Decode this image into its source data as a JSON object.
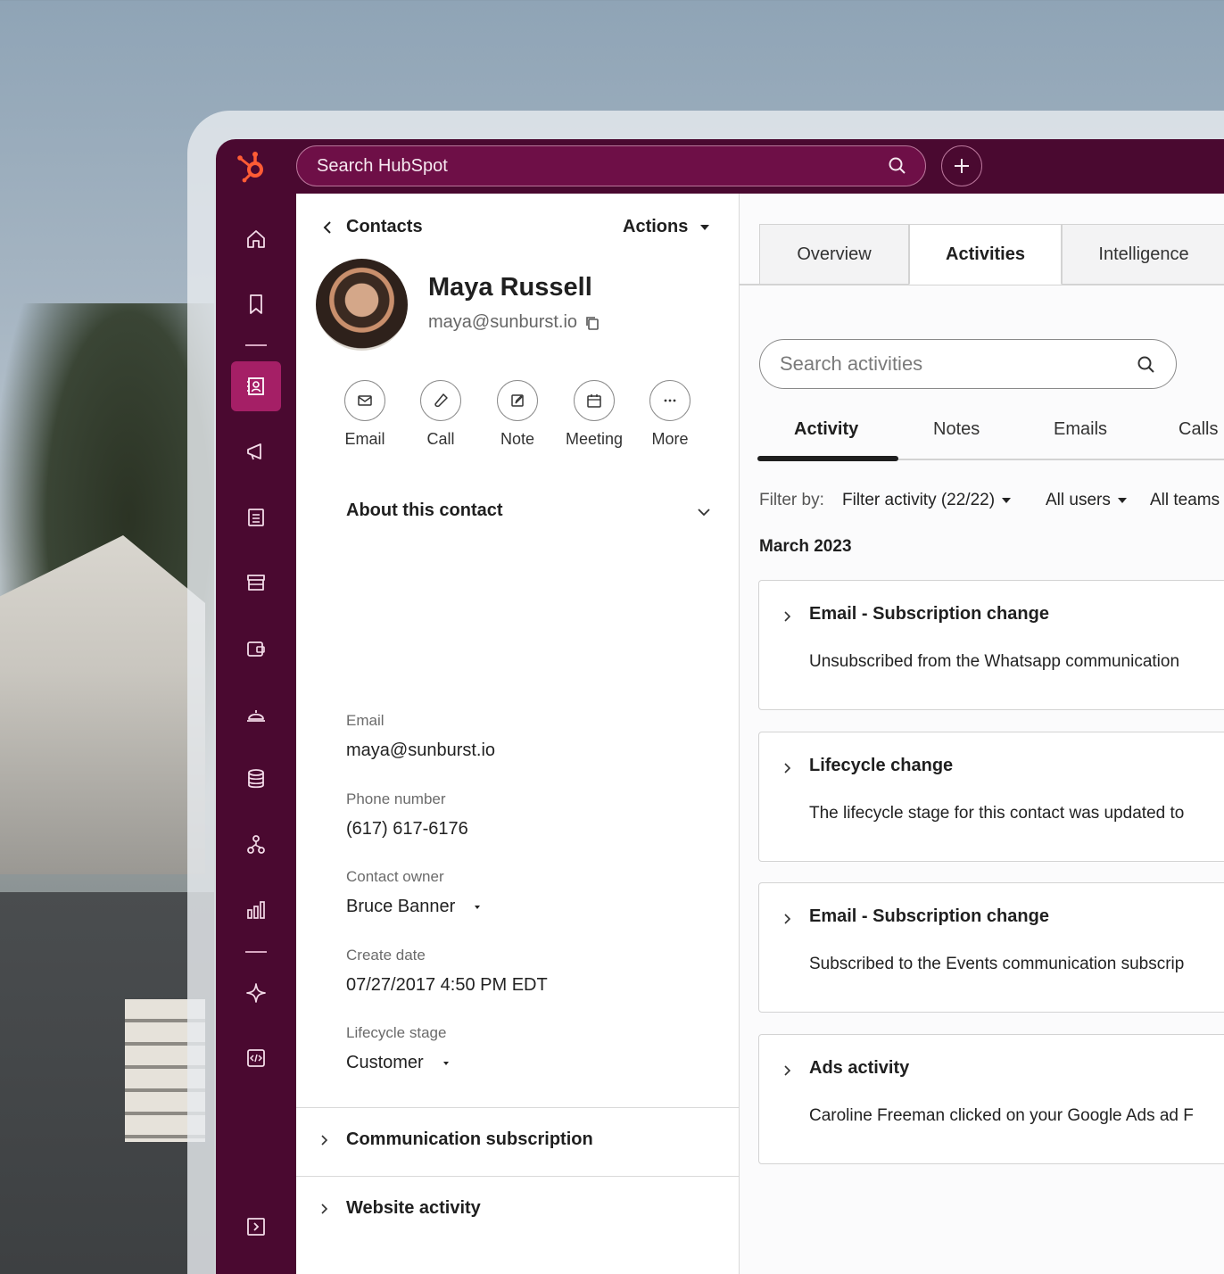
{
  "topbar": {
    "search_placeholder": "Search HubSpot"
  },
  "contact_panel": {
    "back_label": "Contacts",
    "actions_label": "Actions",
    "name": "Maya Russell",
    "email": "maya@sunburst.io",
    "quick_actions": [
      {
        "label": "Email",
        "icon": "mail-icon"
      },
      {
        "label": "Call",
        "icon": "phone-icon"
      },
      {
        "label": "Note",
        "icon": "note-icon"
      },
      {
        "label": "Meeting",
        "icon": "calendar-icon"
      },
      {
        "label": "More",
        "icon": "more-icon"
      }
    ],
    "about_title": "About this contact",
    "fields": [
      {
        "label": "Email",
        "value": "maya@sunburst.io"
      },
      {
        "label": "Phone number",
        "value": "(617) 617-6176"
      },
      {
        "label": "Contact owner",
        "value": "Bruce Banner"
      },
      {
        "label": "Create date",
        "value": "07/27/2017 4:50 PM EDT"
      },
      {
        "label": "Lifecycle stage",
        "value": "Customer"
      }
    ],
    "sections": [
      "Communication subscription",
      "Website activity"
    ]
  },
  "record_panel": {
    "tabs": [
      "Overview",
      "Activities",
      "Intelligence"
    ],
    "active_tab": "Activities",
    "search_placeholder": "Search activities",
    "subtabs": [
      "Activity",
      "Notes",
      "Emails",
      "Calls"
    ],
    "filter_label": "Filter by:",
    "filters": [
      "Filter activity (22/22)",
      "All users",
      "All teams"
    ],
    "month": "March 2023",
    "activities": [
      {
        "title": "Email - Subscription change",
        "body": "Unsubscribed from the Whatsapp communication"
      },
      {
        "title": "Lifecycle change",
        "body": "The lifecycle stage for this contact was updated to"
      },
      {
        "title": "Email - Subscription change",
        "body": "Subscribed to the Events communication subscrip"
      },
      {
        "title": "Ads activity",
        "body": "Caroline Freeman clicked on your Google Ads ad F"
      }
    ]
  },
  "colors": {
    "brand": "#4a0930",
    "accent": "#a51f66",
    "logo": "#ff5c35"
  }
}
